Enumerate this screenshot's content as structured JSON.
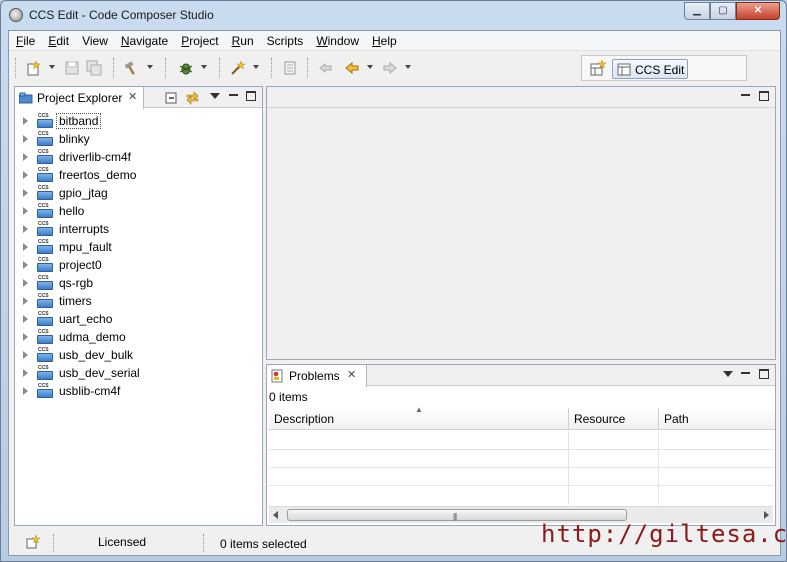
{
  "window": {
    "title": "CCS Edit - Code Composer Studio",
    "min": "0",
    "max": "1",
    "close": "r"
  },
  "menu": [
    {
      "key": "F",
      "rest": "ile"
    },
    {
      "key": "E",
      "rest": "dit"
    },
    {
      "key": "",
      "rest": "View"
    },
    {
      "key": "N",
      "rest": "avigate"
    },
    {
      "key": "P",
      "rest": "roject"
    },
    {
      "key": "R",
      "rest": "un"
    },
    {
      "key": "",
      "rest": "Scripts"
    },
    {
      "key": "W",
      "rest": "indow"
    },
    {
      "key": "H",
      "rest": "elp"
    }
  ],
  "perspective": {
    "label": "CCS Edit"
  },
  "project_explorer": {
    "tab_label": "Project Explorer",
    "projects": [
      "bitband",
      "blinky",
      "driverlib-cm4f",
      "freertos_demo",
      "gpio_jtag",
      "hello",
      "interrupts",
      "mpu_fault",
      "project0",
      "qs-rgb",
      "timers",
      "uart_echo",
      "udma_demo",
      "usb_dev_bulk",
      "usb_dev_serial",
      "usblib-cm4f"
    ],
    "project_badge": "CCS"
  },
  "problems": {
    "tab_label": "Problems",
    "count_text": "0 items",
    "columns": [
      "Description",
      "Resource",
      "Path"
    ]
  },
  "status": {
    "license": "Licensed",
    "selection": "0 items selected"
  },
  "watermark": "http://giltesa.com",
  "colors": {
    "accent": "#3d7dc7",
    "watermark": "#8b1a1a"
  }
}
